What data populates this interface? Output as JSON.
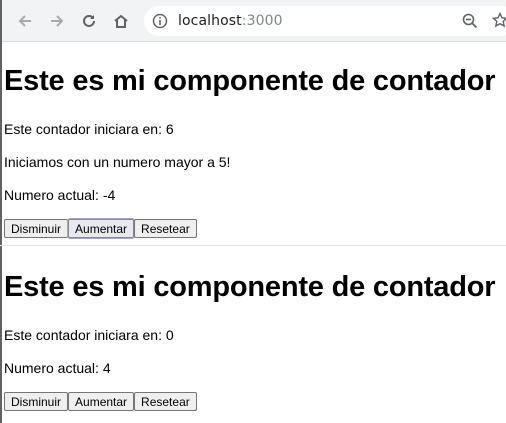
{
  "browser": {
    "url_host": "localhost",
    "url_port": ":3000",
    "icons": [
      "back-arrow-icon",
      "forward-arrow-icon",
      "reload-icon",
      "home-icon",
      "info-icon",
      "zoom-out-icon",
      "bookmark-star-icon"
    ]
  },
  "counters": [
    {
      "title": "Este es mi componente de contador",
      "start_text": "Este contador iniciara en: 6",
      "message": "Iniciamos con un numero mayor a 5!",
      "current_text": "Numero actual: -4",
      "buttons": {
        "decrease": "Disminuir",
        "increase": "Aumentar",
        "reset": "Resetear"
      }
    },
    {
      "title": "Este es mi componente de contador",
      "start_text": "Este contador iniciara en: 0",
      "current_text": "Numero actual: 4",
      "buttons": {
        "decrease": "Disminuir",
        "increase": "Aumentar",
        "reset": "Resetear"
      }
    }
  ]
}
